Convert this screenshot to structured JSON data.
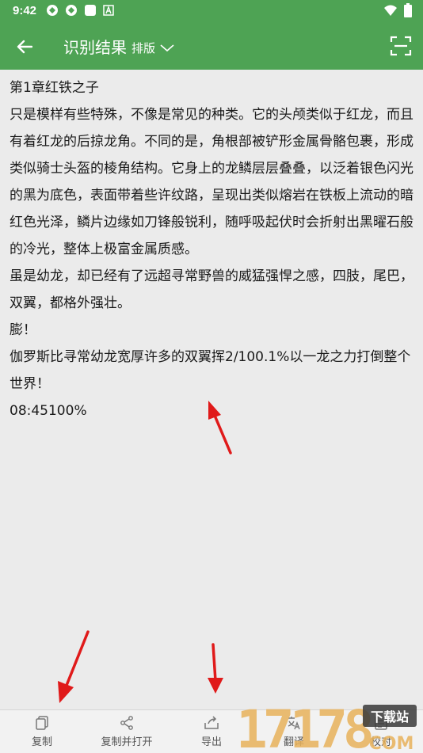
{
  "status_bar": {
    "time": "9:42"
  },
  "app_bar": {
    "title": "识别结果",
    "layout_label": "排版"
  },
  "content": {
    "paragraphs": [
      "第1章红铁之子",
      "只是模样有些特殊，不像是常见的种类。它的头颅类似于红龙，而且有着红龙的后掠龙角。不同的是，角根部被铲形金属骨骼包裹，形成类似骑士头盔的棱角结构。它身上的龙鳞层层叠叠，以泛着银色闪光的黑为底色，表面带着些许纹路，呈现出类似熔岩在铁板上流动的暗红色光泽，鳞片边缘如刀锋般锐利，随呼吸起伏时会折射出黑曜石般的冷光，整体上极富金属质感。",
      "虽是幼龙，却已经有了远超寻常野兽的威猛强悍之感，四肢，尾巴，双翼，都格外强壮。",
      "膨！",
      "伽罗斯比寻常幼龙宽厚许多的双翼挥2/100.1%以一龙之力打倒整个世界！",
      "08:45100%"
    ]
  },
  "bottom_bar": {
    "tabs": [
      {
        "label": "复制",
        "icon": "copy-icon"
      },
      {
        "label": "复制并打开",
        "icon": "share-icon"
      },
      {
        "label": "导出",
        "icon": "export-icon"
      },
      {
        "label": "翻译",
        "icon": "translate-icon"
      },
      {
        "label": "校对",
        "icon": "proofread-icon"
      }
    ]
  },
  "watermark": {
    "text": "17178",
    "badge": "下载站",
    "domain": "COM"
  },
  "colors": {
    "accent": "#4ea354",
    "annotation_arrow": "#e01a1a",
    "watermark_orange": "#e8b25a"
  }
}
